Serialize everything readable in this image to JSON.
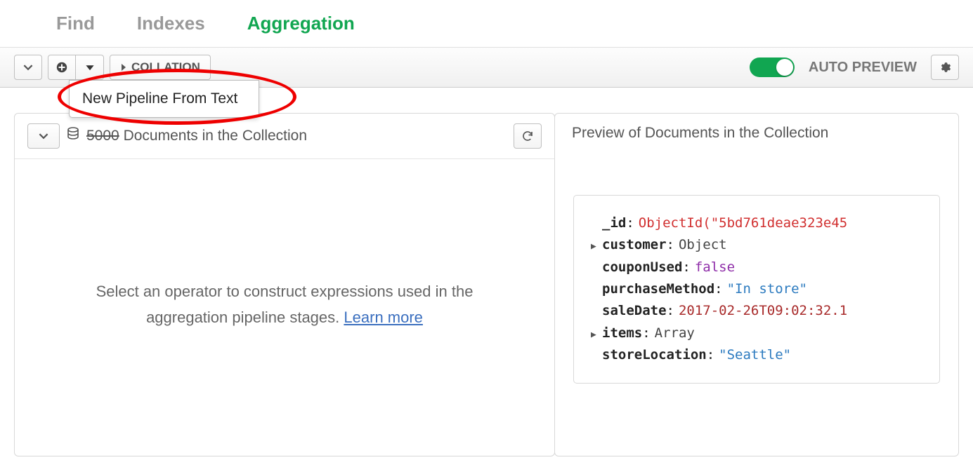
{
  "tabs": {
    "find": "Find",
    "indexes": "Indexes",
    "aggregation": "Aggregation",
    "active": "aggregation"
  },
  "toolbar": {
    "collation_label": "COLLATION",
    "auto_preview_label": "AUTO PREVIEW",
    "auto_preview_on": true
  },
  "dropdown": {
    "new_pipeline_from_text": "New Pipeline From Text"
  },
  "left_pane": {
    "doc_count": "5000",
    "doc_count_suffix": "Documents in the Collection",
    "placeholder_text": "Select an operator to construct expressions used in the aggregation pipeline stages.",
    "learn_more": "Learn more"
  },
  "right_pane": {
    "title": "Preview of Documents in the Collection",
    "document": {
      "id_key": "_id",
      "id_val": "ObjectId(\"5bd761deae323e45",
      "customer_key": "customer",
      "customer_val": "Object",
      "couponUsed_key": "couponUsed",
      "couponUsed_val": "false",
      "purchaseMethod_key": "purchaseMethod",
      "purchaseMethod_val": "\"In store\"",
      "saleDate_key": "saleDate",
      "saleDate_val": "2017-02-26T09:02:32.1",
      "items_key": "items",
      "items_val": "Array",
      "storeLocation_key": "storeLocation",
      "storeLocation_val": "\"Seattle\""
    }
  }
}
